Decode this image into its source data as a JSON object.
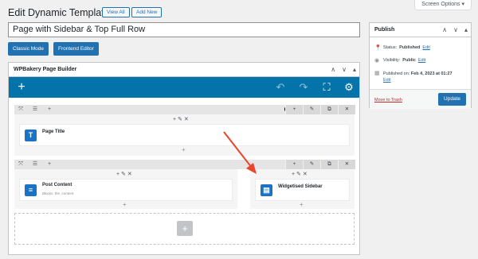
{
  "screen_options": "Screen Options ▾",
  "header": {
    "title": "Edit Dynamic Template",
    "view_all": "View All",
    "add_new": "Add New"
  },
  "title_field": {
    "value": "Page with Sidebar & Top Full Row"
  },
  "mode_buttons": {
    "classic": "Classic Mode",
    "frontend": "Frontend Editor"
  },
  "wpbakery": {
    "title": "WPBakery Page Builder",
    "header_icons": [
      "∧",
      "∨",
      "▴"
    ],
    "toolbar": {
      "add": "+",
      "undo": "↶",
      "redo": "↷",
      "fullscreen": "⛶",
      "settings": "⚙"
    },
    "rows": [
      {
        "controls": [
          "+",
          "✎",
          "⧉",
          "✕"
        ],
        "column_controls": "+ ✎ ✕",
        "elements": [
          {
            "title": "Page Title",
            "sub": "",
            "icon": "T"
          }
        ],
        "add": "+"
      },
      {
        "controls": [
          "+",
          "✎",
          "⧉",
          "✕"
        ],
        "column_controls": "+ ✎ ✕",
        "elements": [
          {
            "title": "Post Content",
            "sub": "Blocks: the_content",
            "icon": "≡"
          },
          {
            "title": "Widgetised Sidebar",
            "sub": "",
            "icon": "▤"
          }
        ],
        "add": "+"
      }
    ],
    "add_row": "+"
  },
  "publish": {
    "title": "Publish",
    "header_icons": [
      "∧",
      "∨",
      "▴"
    ],
    "status_label": "Status:",
    "status_value": "Published",
    "visibility_label": "Visibility:",
    "visibility_value": "Public",
    "published_label": "Published on:",
    "published_value": "Feb 4, 2023 at 01:27",
    "edit": "Edit",
    "trash": "Move to Trash",
    "update": "Update"
  },
  "colors": {
    "accent": "#2271b1",
    "toolbar": "#0473aa",
    "danger": "#b32d2e",
    "annotation_arrow": "#e8452c"
  }
}
